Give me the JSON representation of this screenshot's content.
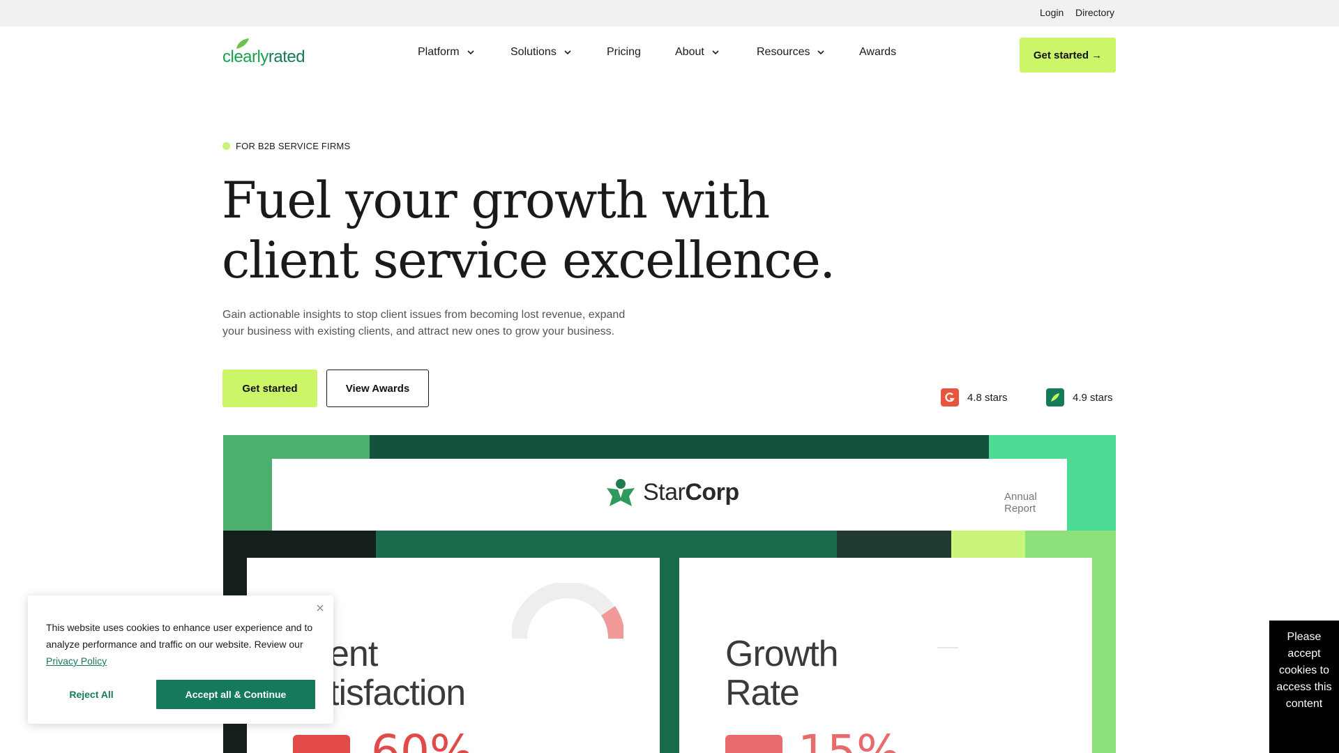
{
  "utility": {
    "login": "Login",
    "directory": "Directory"
  },
  "logo": {
    "part1": "clearly",
    "part2": "rated"
  },
  "nav": [
    {
      "label": "Platform",
      "dropdown": true
    },
    {
      "label": "Solutions",
      "dropdown": true
    },
    {
      "label": "Pricing",
      "dropdown": false
    },
    {
      "label": "About",
      "dropdown": true
    },
    {
      "label": "Resources",
      "dropdown": true
    },
    {
      "label": "Awards",
      "dropdown": false
    }
  ],
  "header": {
    "cta": "Get started →"
  },
  "hero": {
    "eyebrow": "FOR B2B SERVICE FIRMS",
    "title_line1": "Fuel your growth with",
    "title_line2": "client service excellence.",
    "subtitle": "Gain actionable insights to stop client issues from becoming lost revenue, expand your business with existing clients, and attract new ones to grow your business.",
    "primary_button": "Get started",
    "secondary_button": "View Awards"
  },
  "ratings": [
    {
      "icon": "g2-icon",
      "text": "4.8 stars",
      "color": "#e8553c"
    },
    {
      "icon": "leaf-icon",
      "text": "4.9 stars",
      "color": "#157a5c"
    }
  ],
  "showcase": {
    "company_light": "Star",
    "company_bold": "Corp",
    "annual_report": "Annual Report",
    "left_panel_line1": "ent",
    "left_panel_line2": "tisfaction",
    "left_stat": "60%",
    "right_panel_line1": "Growth",
    "right_panel_line2": "Rate",
    "right_stat": "15%"
  },
  "cookie": {
    "text_before_link": "This website uses cookies to enhance user experience and to analyze performance and traffic on our website. Review our ",
    "link": "Privacy Policy",
    "reject": "Reject All",
    "accept": "Accept all & Continue"
  },
  "cookie_notice": "Please accept cookies to access this content",
  "colors": {
    "accent": "#cdf56a",
    "brand": "#157a5c"
  }
}
